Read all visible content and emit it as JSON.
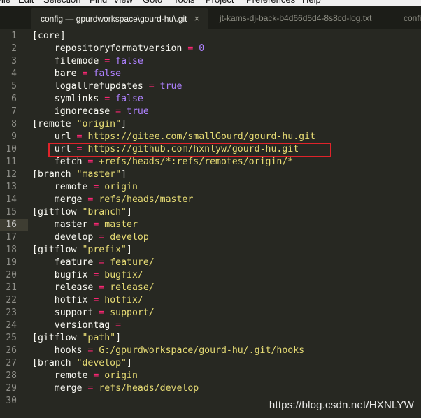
{
  "menubar": {
    "items": [
      "File",
      "Edit",
      "Selection",
      "Find",
      "View",
      "Goto",
      "Tools",
      "Project",
      "Preferences",
      "Help"
    ]
  },
  "tabs": [
    {
      "label": "config — gpurdworkspace\\gourd-hu\\.git",
      "active": true,
      "close": "×"
    },
    {
      "label": "jt-kams-dj-back-b4d66d5d4-8s8cd-log.txt",
      "active": false
    },
    {
      "label": "confi",
      "active": false
    }
  ],
  "editor": {
    "current_line": 16,
    "lines": [
      [
        [
          "plain",
          "[core]"
        ]
      ],
      [
        [
          "plain",
          "    repositoryformatversion "
        ],
        [
          "kw",
          "="
        ],
        [
          "plain",
          " "
        ],
        [
          "val",
          "0"
        ]
      ],
      [
        [
          "plain",
          "    filemode "
        ],
        [
          "kw",
          "="
        ],
        [
          "plain",
          " "
        ],
        [
          "val",
          "false"
        ]
      ],
      [
        [
          "plain",
          "    bare "
        ],
        [
          "kw",
          "="
        ],
        [
          "plain",
          " "
        ],
        [
          "val",
          "false"
        ]
      ],
      [
        [
          "plain",
          "    logallrefupdates "
        ],
        [
          "kw",
          "="
        ],
        [
          "plain",
          " "
        ],
        [
          "val",
          "true"
        ]
      ],
      [
        [
          "plain",
          "    symlinks "
        ],
        [
          "kw",
          "="
        ],
        [
          "plain",
          " "
        ],
        [
          "val",
          "false"
        ]
      ],
      [
        [
          "plain",
          "    ignorecase "
        ],
        [
          "kw",
          "="
        ],
        [
          "plain",
          " "
        ],
        [
          "val",
          "true"
        ]
      ],
      [
        [
          "plain",
          "[remote "
        ],
        [
          "str",
          "\"origin\""
        ],
        [
          "plain",
          "]"
        ]
      ],
      [
        [
          "plain",
          "    url "
        ],
        [
          "kw",
          "="
        ],
        [
          "plain",
          " "
        ],
        [
          "str",
          "https://gitee.com/smallGourd/gourd-hu.git"
        ]
      ],
      [
        [
          "plain",
          "    url "
        ],
        [
          "kw",
          "="
        ],
        [
          "plain",
          " "
        ],
        [
          "str",
          "https://github.com/hxnlyw/gourd-hu.git"
        ]
      ],
      [
        [
          "plain",
          "    fetch "
        ],
        [
          "kw",
          "="
        ],
        [
          "plain",
          " "
        ],
        [
          "str",
          "+refs/heads/*:refs/remotes/origin/*"
        ]
      ],
      [
        [
          "plain",
          "[branch "
        ],
        [
          "str",
          "\"master\""
        ],
        [
          "plain",
          "]"
        ]
      ],
      [
        [
          "plain",
          "    remote "
        ],
        [
          "kw",
          "="
        ],
        [
          "plain",
          " "
        ],
        [
          "str",
          "origin"
        ]
      ],
      [
        [
          "plain",
          "    merge "
        ],
        [
          "kw",
          "="
        ],
        [
          "plain",
          " "
        ],
        [
          "str",
          "refs/heads/master"
        ]
      ],
      [
        [
          "plain",
          "[gitflow "
        ],
        [
          "str",
          "\"branch\""
        ],
        [
          "plain",
          "]"
        ]
      ],
      [
        [
          "plain",
          "    master "
        ],
        [
          "kw",
          "="
        ],
        [
          "plain",
          " "
        ],
        [
          "str",
          "master"
        ]
      ],
      [
        [
          "plain",
          "    develop "
        ],
        [
          "kw",
          "="
        ],
        [
          "plain",
          " "
        ],
        [
          "str",
          "develop"
        ]
      ],
      [
        [
          "plain",
          "[gitflow "
        ],
        [
          "str",
          "\"prefix\""
        ],
        [
          "plain",
          "]"
        ]
      ],
      [
        [
          "plain",
          "    feature "
        ],
        [
          "kw",
          "="
        ],
        [
          "plain",
          " "
        ],
        [
          "str",
          "feature/"
        ]
      ],
      [
        [
          "plain",
          "    bugfix "
        ],
        [
          "kw",
          "="
        ],
        [
          "plain",
          " "
        ],
        [
          "str",
          "bugfix/"
        ]
      ],
      [
        [
          "plain",
          "    release "
        ],
        [
          "kw",
          "="
        ],
        [
          "plain",
          " "
        ],
        [
          "str",
          "release/"
        ]
      ],
      [
        [
          "plain",
          "    hotfix "
        ],
        [
          "kw",
          "="
        ],
        [
          "plain",
          " "
        ],
        [
          "str",
          "hotfix/"
        ]
      ],
      [
        [
          "plain",
          "    support "
        ],
        [
          "kw",
          "="
        ],
        [
          "plain",
          " "
        ],
        [
          "str",
          "support/"
        ]
      ],
      [
        [
          "plain",
          "    versiontag "
        ],
        [
          "kw",
          "="
        ]
      ],
      [
        [
          "plain",
          "[gitflow "
        ],
        [
          "str",
          "\"path\""
        ],
        [
          "plain",
          "]"
        ]
      ],
      [
        [
          "plain",
          "    hooks "
        ],
        [
          "kw",
          "="
        ],
        [
          "plain",
          " "
        ],
        [
          "str",
          "G:/gpurdworkspace/gourd-hu/.git/hooks"
        ]
      ],
      [
        [
          "plain",
          "[branch "
        ],
        [
          "str",
          "\"develop\""
        ],
        [
          "plain",
          "]"
        ]
      ],
      [
        [
          "plain",
          "    remote "
        ],
        [
          "kw",
          "="
        ],
        [
          "plain",
          " "
        ],
        [
          "str",
          "origin"
        ]
      ],
      [
        [
          "plain",
          "    merge "
        ],
        [
          "kw",
          "="
        ],
        [
          "plain",
          " "
        ],
        [
          "str",
          "refs/heads/develop"
        ]
      ],
      []
    ]
  },
  "highlight": {
    "line": 10,
    "color": "#e0232a"
  },
  "watermark": "https://blog.csdn.net/HXNLYW",
  "colors": {
    "background": "#272822",
    "keyword": "#f92672",
    "constant": "#ae81ff",
    "string": "#e6db74",
    "text": "#f8f8f2"
  }
}
